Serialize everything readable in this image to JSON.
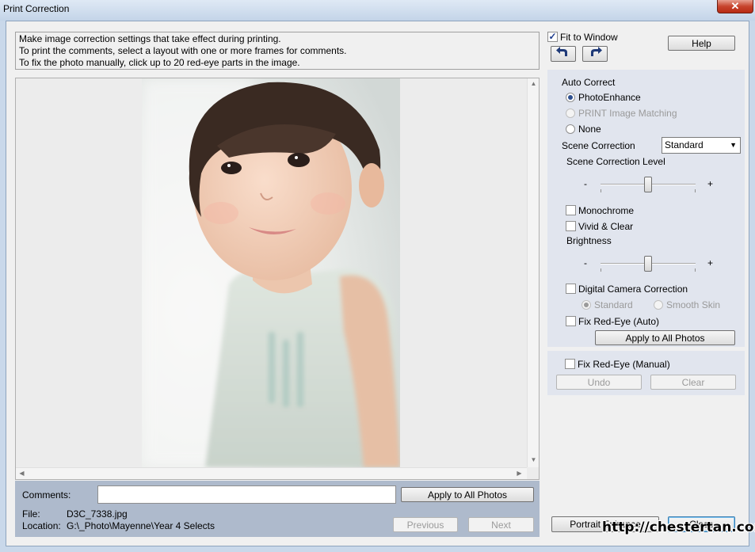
{
  "window": {
    "title": "Print Correction",
    "close_glyph": "✕"
  },
  "info": {
    "lines": [
      "Make image correction settings that take effect during printing.",
      "To print the comments, select a layout with one or more frames for comments.",
      "To fix the photo manually, click up to 20 red-eye parts in the image."
    ]
  },
  "toolbar": {
    "fit_to_window": {
      "label": "Fit to Window",
      "checked": true
    },
    "help_label": "Help",
    "rotate_left_icon": "rotate-left-icon",
    "rotate_right_icon": "rotate-right-icon"
  },
  "auto_correct": {
    "heading": "Auto Correct",
    "options": [
      {
        "label": "PhotoEnhance",
        "selected": true,
        "enabled": true
      },
      {
        "label": "PRINT Image Matching",
        "selected": false,
        "enabled": false
      },
      {
        "label": "None",
        "selected": false,
        "enabled": true
      }
    ],
    "scene_correction_label": "Scene Correction",
    "scene_correction_value": "Standard",
    "scene_level_label": "Scene Correction Level",
    "scene_level_minus": "-",
    "scene_level_plus": "+",
    "scene_level_value": 0.5,
    "monochrome_label": "Monochrome",
    "vivid_label": "Vivid & Clear",
    "brightness_label": "Brightness",
    "brightness_minus": "-",
    "brightness_plus": "+",
    "brightness_value": 0.5,
    "digital_camera_label": "Digital Camera Correction",
    "dc_standard_label": "Standard",
    "dc_smooth_label": "Smooth Skin",
    "red_eye_auto_label": "Fix Red-Eye (Auto)",
    "apply_all_label": "Apply to All Photos"
  },
  "manual": {
    "red_eye_manual_label": "Fix Red-Eye (Manual)",
    "undo_label": "Undo",
    "clear_label": "Clear"
  },
  "bottom": {
    "comments_label": "Comments:",
    "comments_value": "",
    "apply_all_label": "Apply to All Photos",
    "file_label": "File:",
    "file_value": "D3C_7338.jpg",
    "location_label": "Location:",
    "location_value": "G:\\_Photo\\Mayenne\\Year 4 Selects",
    "previous_label": "Previous",
    "next_label": "Next"
  },
  "footer": {
    "portrait_label": "Portrait Enhance",
    "close_label": "Close"
  },
  "watermark": "http://chestertan.com/"
}
